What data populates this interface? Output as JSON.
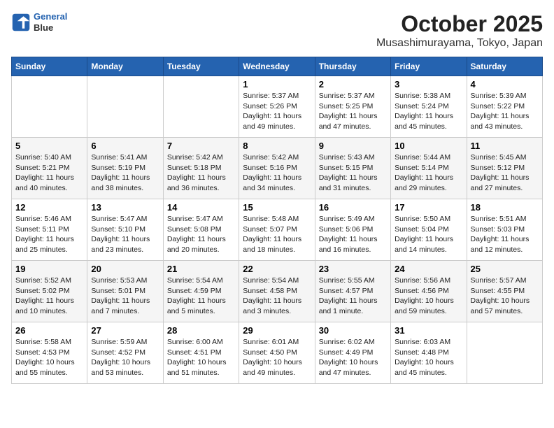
{
  "header": {
    "logo_line1": "General",
    "logo_line2": "Blue",
    "title": "October 2025",
    "subtitle": "Musashimurayama, Tokyo, Japan"
  },
  "weekdays": [
    "Sunday",
    "Monday",
    "Tuesday",
    "Wednesday",
    "Thursday",
    "Friday",
    "Saturday"
  ],
  "weeks": [
    [
      {
        "day": "",
        "text": ""
      },
      {
        "day": "",
        "text": ""
      },
      {
        "day": "",
        "text": ""
      },
      {
        "day": "1",
        "text": "Sunrise: 5:37 AM\nSunset: 5:26 PM\nDaylight: 11 hours and 49 minutes."
      },
      {
        "day": "2",
        "text": "Sunrise: 5:37 AM\nSunset: 5:25 PM\nDaylight: 11 hours and 47 minutes."
      },
      {
        "day": "3",
        "text": "Sunrise: 5:38 AM\nSunset: 5:24 PM\nDaylight: 11 hours and 45 minutes."
      },
      {
        "day": "4",
        "text": "Sunrise: 5:39 AM\nSunset: 5:22 PM\nDaylight: 11 hours and 43 minutes."
      }
    ],
    [
      {
        "day": "5",
        "text": "Sunrise: 5:40 AM\nSunset: 5:21 PM\nDaylight: 11 hours and 40 minutes."
      },
      {
        "day": "6",
        "text": "Sunrise: 5:41 AM\nSunset: 5:19 PM\nDaylight: 11 hours and 38 minutes."
      },
      {
        "day": "7",
        "text": "Sunrise: 5:42 AM\nSunset: 5:18 PM\nDaylight: 11 hours and 36 minutes."
      },
      {
        "day": "8",
        "text": "Sunrise: 5:42 AM\nSunset: 5:16 PM\nDaylight: 11 hours and 34 minutes."
      },
      {
        "day": "9",
        "text": "Sunrise: 5:43 AM\nSunset: 5:15 PM\nDaylight: 11 hours and 31 minutes."
      },
      {
        "day": "10",
        "text": "Sunrise: 5:44 AM\nSunset: 5:14 PM\nDaylight: 11 hours and 29 minutes."
      },
      {
        "day": "11",
        "text": "Sunrise: 5:45 AM\nSunset: 5:12 PM\nDaylight: 11 hours and 27 minutes."
      }
    ],
    [
      {
        "day": "12",
        "text": "Sunrise: 5:46 AM\nSunset: 5:11 PM\nDaylight: 11 hours and 25 minutes."
      },
      {
        "day": "13",
        "text": "Sunrise: 5:47 AM\nSunset: 5:10 PM\nDaylight: 11 hours and 23 minutes."
      },
      {
        "day": "14",
        "text": "Sunrise: 5:47 AM\nSunset: 5:08 PM\nDaylight: 11 hours and 20 minutes."
      },
      {
        "day": "15",
        "text": "Sunrise: 5:48 AM\nSunset: 5:07 PM\nDaylight: 11 hours and 18 minutes."
      },
      {
        "day": "16",
        "text": "Sunrise: 5:49 AM\nSunset: 5:06 PM\nDaylight: 11 hours and 16 minutes."
      },
      {
        "day": "17",
        "text": "Sunrise: 5:50 AM\nSunset: 5:04 PM\nDaylight: 11 hours and 14 minutes."
      },
      {
        "day": "18",
        "text": "Sunrise: 5:51 AM\nSunset: 5:03 PM\nDaylight: 11 hours and 12 minutes."
      }
    ],
    [
      {
        "day": "19",
        "text": "Sunrise: 5:52 AM\nSunset: 5:02 PM\nDaylight: 11 hours and 10 minutes."
      },
      {
        "day": "20",
        "text": "Sunrise: 5:53 AM\nSunset: 5:01 PM\nDaylight: 11 hours and 7 minutes."
      },
      {
        "day": "21",
        "text": "Sunrise: 5:54 AM\nSunset: 4:59 PM\nDaylight: 11 hours and 5 minutes."
      },
      {
        "day": "22",
        "text": "Sunrise: 5:54 AM\nSunset: 4:58 PM\nDaylight: 11 hours and 3 minutes."
      },
      {
        "day": "23",
        "text": "Sunrise: 5:55 AM\nSunset: 4:57 PM\nDaylight: 11 hours and 1 minute."
      },
      {
        "day": "24",
        "text": "Sunrise: 5:56 AM\nSunset: 4:56 PM\nDaylight: 10 hours and 59 minutes."
      },
      {
        "day": "25",
        "text": "Sunrise: 5:57 AM\nSunset: 4:55 PM\nDaylight: 10 hours and 57 minutes."
      }
    ],
    [
      {
        "day": "26",
        "text": "Sunrise: 5:58 AM\nSunset: 4:53 PM\nDaylight: 10 hours and 55 minutes."
      },
      {
        "day": "27",
        "text": "Sunrise: 5:59 AM\nSunset: 4:52 PM\nDaylight: 10 hours and 53 minutes."
      },
      {
        "day": "28",
        "text": "Sunrise: 6:00 AM\nSunset: 4:51 PM\nDaylight: 10 hours and 51 minutes."
      },
      {
        "day": "29",
        "text": "Sunrise: 6:01 AM\nSunset: 4:50 PM\nDaylight: 10 hours and 49 minutes."
      },
      {
        "day": "30",
        "text": "Sunrise: 6:02 AM\nSunset: 4:49 PM\nDaylight: 10 hours and 47 minutes."
      },
      {
        "day": "31",
        "text": "Sunrise: 6:03 AM\nSunset: 4:48 PM\nDaylight: 10 hours and 45 minutes."
      },
      {
        "day": "",
        "text": ""
      }
    ]
  ]
}
